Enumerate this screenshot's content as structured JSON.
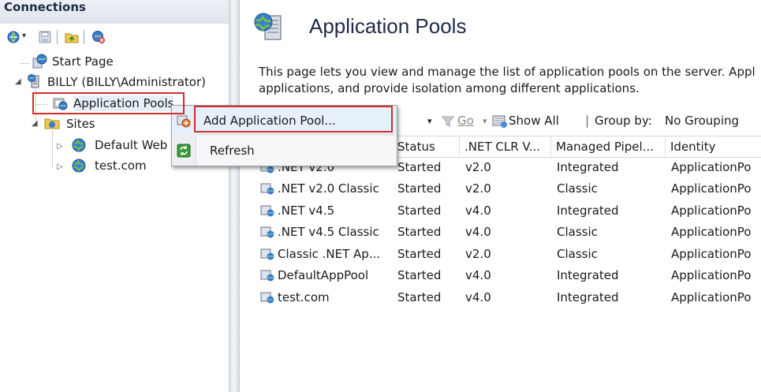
{
  "connections": {
    "title": "Connections",
    "tree": {
      "start_page": "Start Page",
      "server": "BILLY (BILLY\\Administrator)",
      "app_pools": "Application Pools",
      "sites": "Sites",
      "default_web": "Default Web",
      "test_site": "test.com"
    }
  },
  "context_menu": {
    "add_pool": "Add Application Pool...",
    "refresh": "Refresh"
  },
  "main": {
    "title": "Application Pools",
    "description_line1": "This page lets you view and manage the list of application pools on the server. Appl",
    "description_line2": "applications, and provide isolation among different applications.",
    "filter": {
      "go": "Go",
      "show_all": "Show All",
      "group_by_label": "Group by:",
      "group_by_value": "No Grouping"
    },
    "columns": [
      "Status",
      ".NET CLR V...",
      "Managed Pipel...",
      "Identity"
    ],
    "rows": [
      {
        "name": ".NET v2.0",
        "status": "Started",
        "clr": "v2.0",
        "pipeline": "Integrated",
        "identity": "ApplicationPo"
      },
      {
        "name": ".NET v2.0 Classic",
        "status": "Started",
        "clr": "v2.0",
        "pipeline": "Classic",
        "identity": "ApplicationPo"
      },
      {
        "name": ".NET v4.5",
        "status": "Started",
        "clr": "v4.0",
        "pipeline": "Integrated",
        "identity": "ApplicationPo"
      },
      {
        "name": ".NET v4.5 Classic",
        "status": "Started",
        "clr": "v4.0",
        "pipeline": "Classic",
        "identity": "ApplicationPo"
      },
      {
        "name": "Classic .NET Ap...",
        "status": "Started",
        "clr": "v2.0",
        "pipeline": "Classic",
        "identity": "ApplicationPo"
      },
      {
        "name": "DefaultAppPool",
        "status": "Started",
        "clr": "v4.0",
        "pipeline": "Integrated",
        "identity": "ApplicationPo"
      },
      {
        "name": "test.com",
        "status": "Started",
        "clr": "v4.0",
        "pipeline": "Integrated",
        "identity": "ApplicationPo"
      }
    ]
  },
  "icons": {
    "connect": "connect-icon",
    "save": "save-icon",
    "up": "up-folder-icon",
    "disconnect": "disconnect-icon",
    "server": "server-icon",
    "app_pool": "app-pool-icon",
    "site": "globe-icon",
    "refresh": "refresh-icon"
  },
  "colors": {
    "highlight": "#d42c2c",
    "menu_hover": "#e5f0fb",
    "title": "#1e2b45"
  }
}
